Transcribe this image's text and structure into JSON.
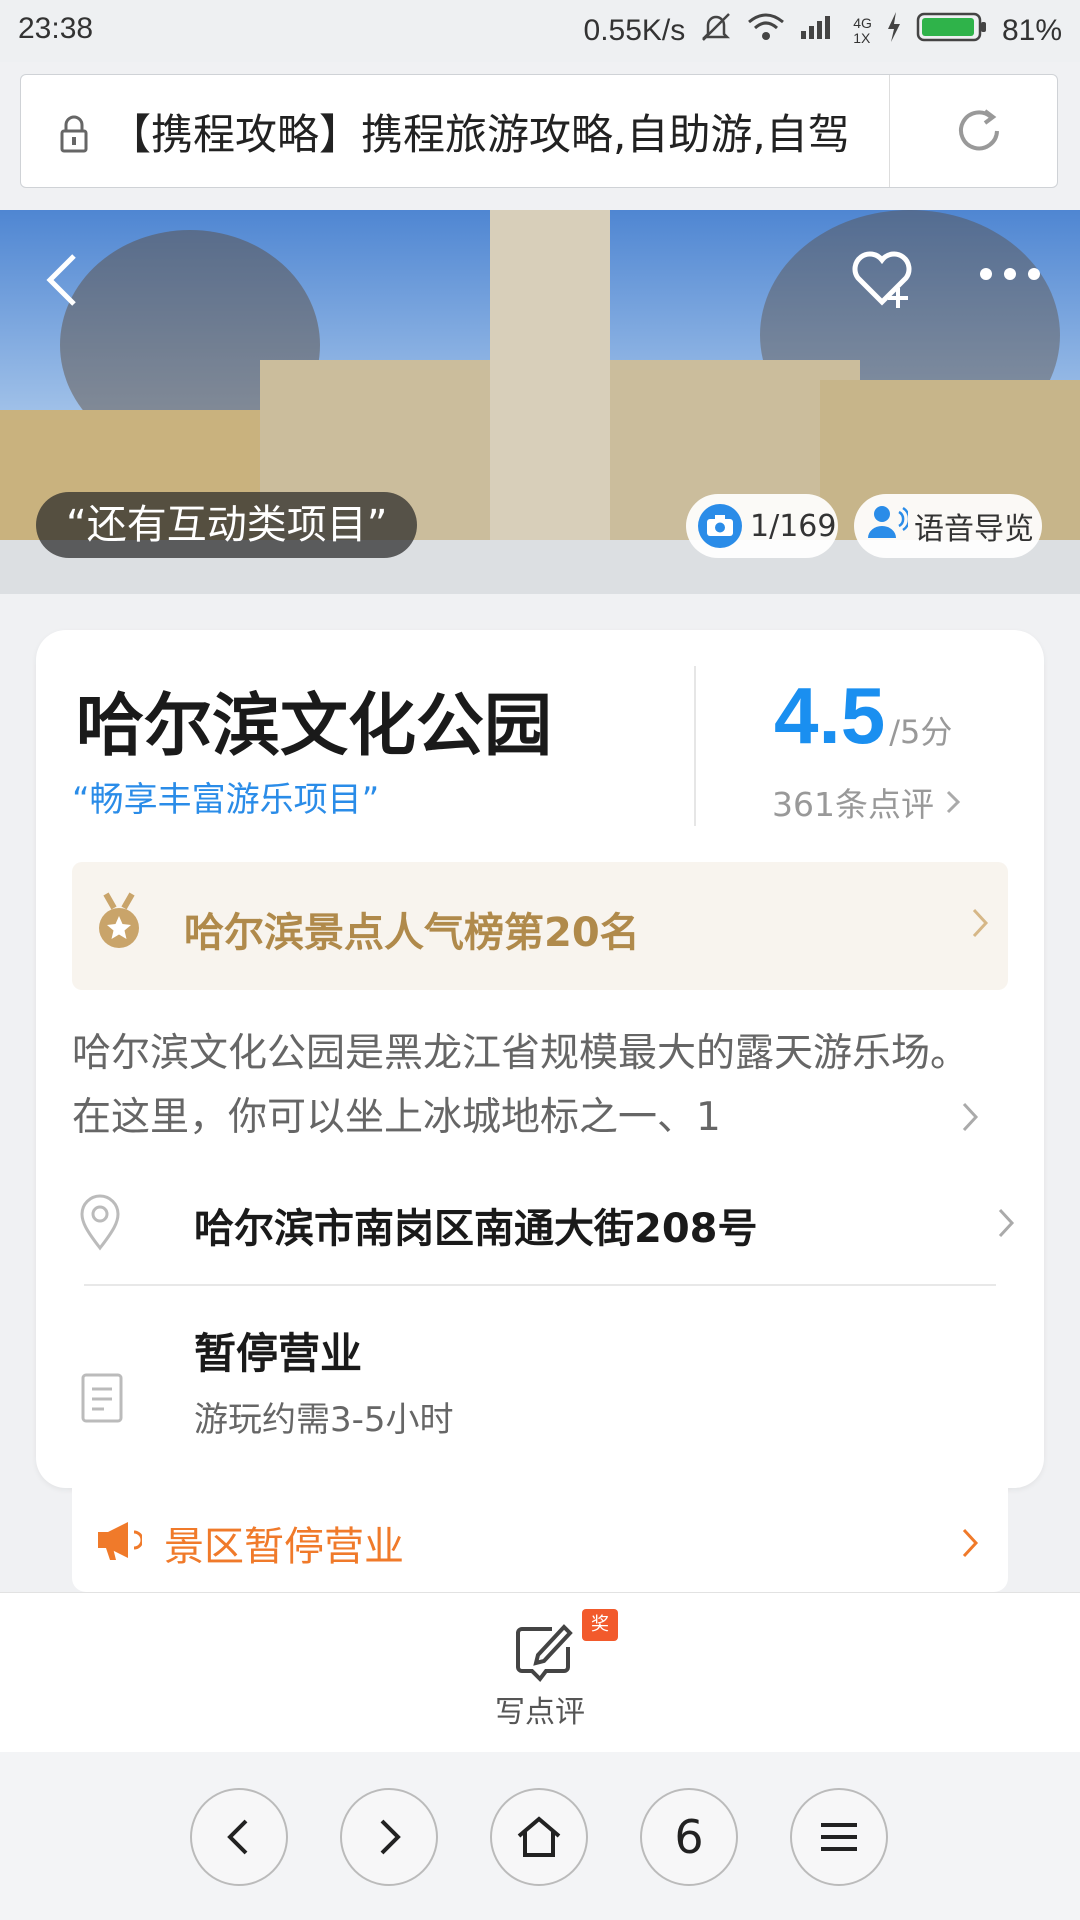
{
  "status_bar": {
    "time": "23:38",
    "net_speed": "0.55K/s",
    "network_top": "4G",
    "network_bottom": "1X",
    "battery": "81%"
  },
  "url_bar": {
    "text": "【携程攻略】携程旅游攻略,自助游,自驾"
  },
  "hero": {
    "quote": "“还有互动类项目”",
    "photo_count": "1/169",
    "voice_guide": "语音导览"
  },
  "attraction": {
    "name": "哈尔滨文化公园",
    "slogan": "“畅享丰富游乐项目”",
    "score": "4.5",
    "score_unit": "/5分",
    "reviews": "361条点评",
    "rank": "哈尔滨景点人气榜第20名",
    "description": "哈尔滨文化公园是黑龙江省规模最大的露天游乐场。在这里，你可以坐上冰城地标之一、1",
    "address": "哈尔滨市南岗区南通大街208号",
    "status": "暂停营业",
    "duration": "游玩约需3-5小时",
    "notice": "景区暂停营业"
  },
  "actions": {
    "write_review": "写点评",
    "badge": "奖"
  },
  "nav": {
    "tabs_count": "6"
  },
  "colors": {
    "accent_blue": "#1a8ff0",
    "rank_gold": "#b08a4b",
    "notice_orange": "#f07a2a"
  }
}
